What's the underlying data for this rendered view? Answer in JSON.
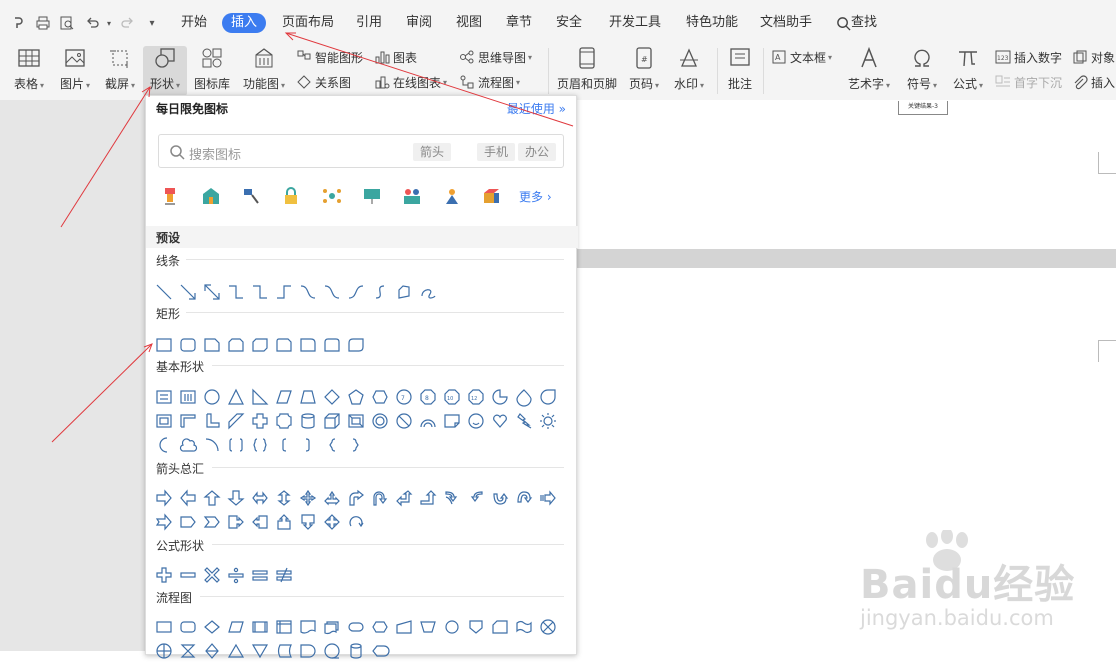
{
  "menu": {
    "tabs": [
      "开始",
      "插入",
      "页面布局",
      "引用",
      "审阅",
      "视图",
      "章节",
      "安全",
      "开发工具",
      "特色功能",
      "文档助手"
    ],
    "active_tab": "插入",
    "search_label": "查找"
  },
  "ribbon": {
    "table": "表格",
    "picture": "图片",
    "screenshot": "截屏",
    "shape": "形状",
    "icon_lib": "图标库",
    "function_chart": "功能图",
    "smart_art": "智能图形",
    "chart": "图表",
    "mind_map": "思维导图",
    "relation": "关系图",
    "online_chart": "在线图表",
    "flowchart": "流程图",
    "header_footer": "页眉和页脚",
    "page_number": "页码",
    "watermark": "水印",
    "comment": "批注",
    "text_box": "文本框",
    "art_text": "艺术字",
    "symbol": "符号",
    "formula": "公式",
    "insert_number": "插入数字",
    "drop_cap": "首字下沉",
    "object": "对象",
    "insert_attach": "插入"
  },
  "document": {
    "thumb_label": "关键结果-3"
  },
  "panel": {
    "header": "每日限免图标",
    "recent": "最近使用",
    "search_placeholder": "搜索图标",
    "tags": [
      "箭头",
      "手机",
      "办公"
    ],
    "more": "更多",
    "preset": "预设",
    "categories": [
      "线条",
      "矩形",
      "基本形状",
      "箭头总汇",
      "公式形状",
      "流程图"
    ]
  },
  "watermark": {
    "brand": "Baidu经验",
    "url": "jingyan.baidu.com"
  },
  "colors": {
    "accent": "#3c7cf0",
    "annotation": "#e0393e",
    "shape_stroke": "#3e6fa8"
  }
}
